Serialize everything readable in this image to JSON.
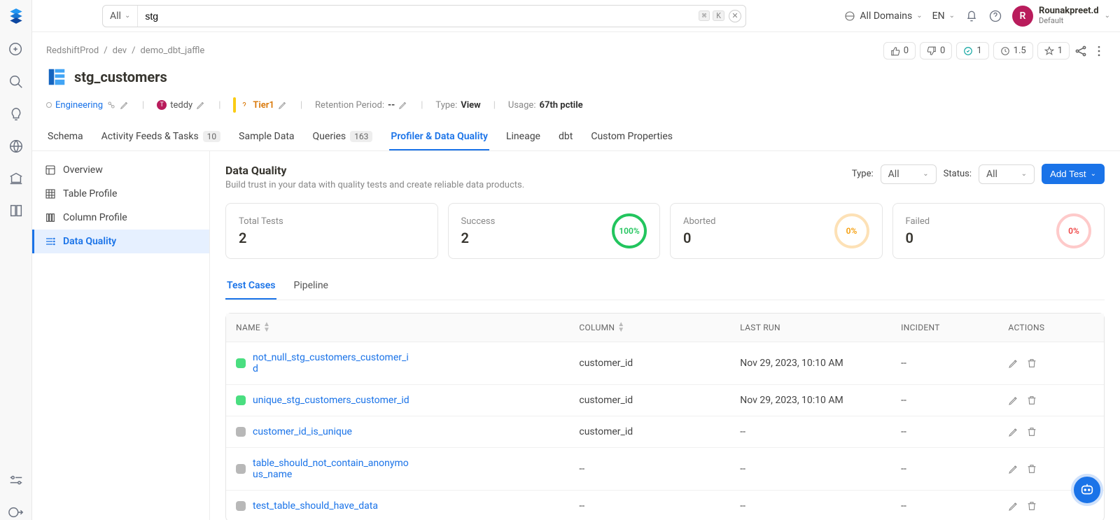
{
  "search": {
    "scope": "All",
    "value": "stg",
    "kbd": "⌘",
    "kbd2": "K"
  },
  "header": {
    "domainLabel": "All Domains",
    "langLabel": "EN",
    "user": {
      "initial": "R",
      "name": "Rounakpreet.d",
      "role": "Default"
    }
  },
  "breadcrumb": [
    "RedshiftProd",
    "dev",
    "demo_dbt_jaffle"
  ],
  "title": "stg_customers",
  "stats": {
    "upvote": "0",
    "downvote": "0",
    "duration": "1",
    "time": "1.5",
    "star": "1"
  },
  "meta": {
    "domain": "Engineering",
    "owner": "teddy",
    "tier": "Tier1",
    "retentionLabel": "Retention Period:",
    "retentionValue": "--",
    "typeLabel": "Type:",
    "typeValue": "View",
    "usageLabel": "Usage:",
    "usageValue": "67th pctile"
  },
  "tabs": [
    {
      "label": "Schema"
    },
    {
      "label": "Activity Feeds & Tasks",
      "count": "10"
    },
    {
      "label": "Sample Data"
    },
    {
      "label": "Queries",
      "count": "163"
    },
    {
      "label": "Profiler & Data Quality",
      "active": true
    },
    {
      "label": "Lineage"
    },
    {
      "label": "dbt"
    },
    {
      "label": "Custom Properties"
    }
  ],
  "sideitems": [
    {
      "label": "Overview"
    },
    {
      "label": "Table Profile"
    },
    {
      "label": "Column Profile"
    },
    {
      "label": "Data Quality",
      "active": true
    }
  ],
  "dq": {
    "title": "Data Quality",
    "subtitle": "Build trust in your data with quality tests and create reliable data products.",
    "typeLabel": "Type:",
    "typeValue": "All",
    "statusLabel": "Status:",
    "statusValue": "All",
    "addTest": "Add Test"
  },
  "cards": {
    "total": {
      "label": "Total Tests",
      "value": "2"
    },
    "success": {
      "label": "Success",
      "value": "2",
      "pct": "100%"
    },
    "aborted": {
      "label": "Aborted",
      "value": "0",
      "pct": "0%"
    },
    "failed": {
      "label": "Failed",
      "value": "0",
      "pct": "0%"
    }
  },
  "subtabs": {
    "t1": "Test Cases",
    "t2": "Pipeline"
  },
  "cols": {
    "name": "NAME",
    "column": "COLUMN",
    "lastrun": "LAST RUN",
    "incident": "INCIDENT",
    "actions": "ACTIONS"
  },
  "rows": [
    {
      "status": "green",
      "name": "not_null_stg_customers_customer_id",
      "column": "customer_id",
      "lastrun": "Nov 29, 2023, 10:10 AM",
      "incident": "--"
    },
    {
      "status": "green",
      "name": "unique_stg_customers_customer_id",
      "column": "customer_id",
      "lastrun": "Nov 29, 2023, 10:10 AM",
      "incident": "--"
    },
    {
      "status": "grey",
      "name": "customer_id_is_unique",
      "column": "customer_id",
      "lastrun": "--",
      "incident": "--"
    },
    {
      "status": "grey",
      "name": "table_should_not_contain_anonymous_name",
      "column": "--",
      "lastrun": "--",
      "incident": "--"
    },
    {
      "status": "grey",
      "name": "test_table_should_have_data",
      "column": "--",
      "lastrun": "--",
      "incident": "--"
    }
  ]
}
